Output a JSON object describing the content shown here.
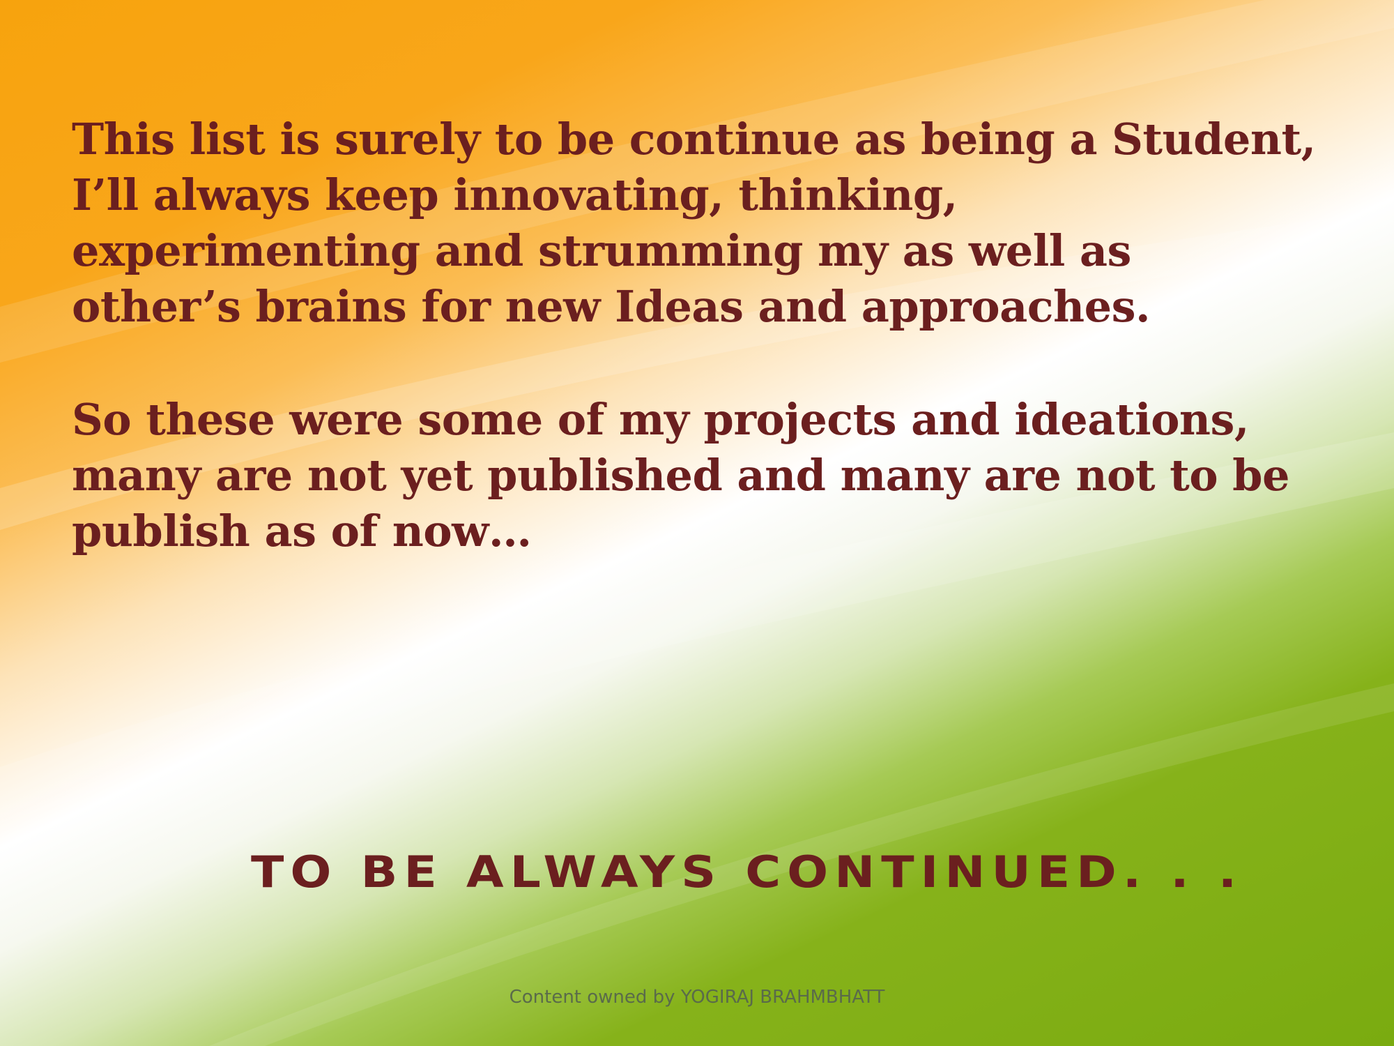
{
  "slide": {
    "background_colors": {
      "saffron": "#f7a30d",
      "white": "#ffffff",
      "green": "#7aab10"
    },
    "text_color": "#6b1f1f",
    "paragraphs": [
      "This list is surely to be continue as being a Student,\nI’ll always keep innovating, thinking,\nexperimenting and strumming my as well as\nother’s brains for new Ideas and approaches.",
      "So these were some of my projects and ideations,\nmany are not yet published and many are not to be\npublish as of now…"
    ],
    "closing": "TO BE ALWAYS CONTINUED. . .",
    "footer": "Content owned by YOGIRAJ BRAHMBHATT"
  }
}
